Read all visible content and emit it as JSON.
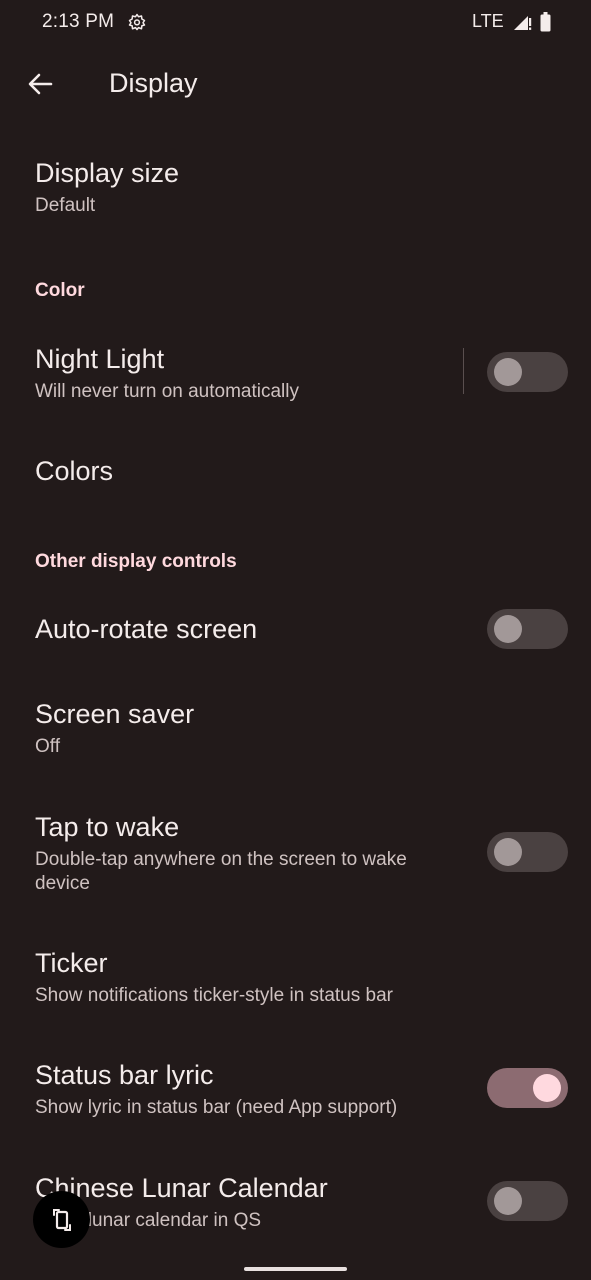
{
  "status_bar": {
    "time": "2:13 PM",
    "network": "LTE",
    "icons": [
      "settings-icon",
      "signal-icon",
      "battery-icon"
    ]
  },
  "app_bar": {
    "title": "Display",
    "back_icon": "arrow-left-icon"
  },
  "items": {
    "display_size": {
      "title": "Display size",
      "subtitle": "Default"
    },
    "color_header": "Color",
    "night_light": {
      "title": "Night Light",
      "subtitle": "Will never turn on automatically",
      "enabled": false
    },
    "colors": {
      "title": "Colors"
    },
    "other_header": "Other display controls",
    "auto_rotate": {
      "title": "Auto-rotate screen",
      "enabled": false
    },
    "screen_saver": {
      "title": "Screen saver",
      "subtitle": "Off"
    },
    "tap_to_wake": {
      "title": "Tap to wake",
      "subtitle": "Double-tap anywhere on the screen to wake device",
      "enabled": false
    },
    "ticker": {
      "title": "Ticker",
      "subtitle": "Show notifications ticker-style in status bar"
    },
    "status_bar_lyric": {
      "title": "Status bar lyric",
      "subtitle": "Show lyric in status bar (need App support)",
      "enabled": true
    },
    "lunar_calendar": {
      "title": "Chinese Lunar Calendar",
      "subtitle": "Show lunar calendar in QS",
      "enabled": false
    }
  },
  "floating_button": {
    "icon": "rotate-screen-icon"
  },
  "colors": {
    "background": "#221a1a",
    "accent": "#ffd9de",
    "toggle_on_track": "#8c6b71",
    "toggle_off_track": "#4a4141"
  }
}
